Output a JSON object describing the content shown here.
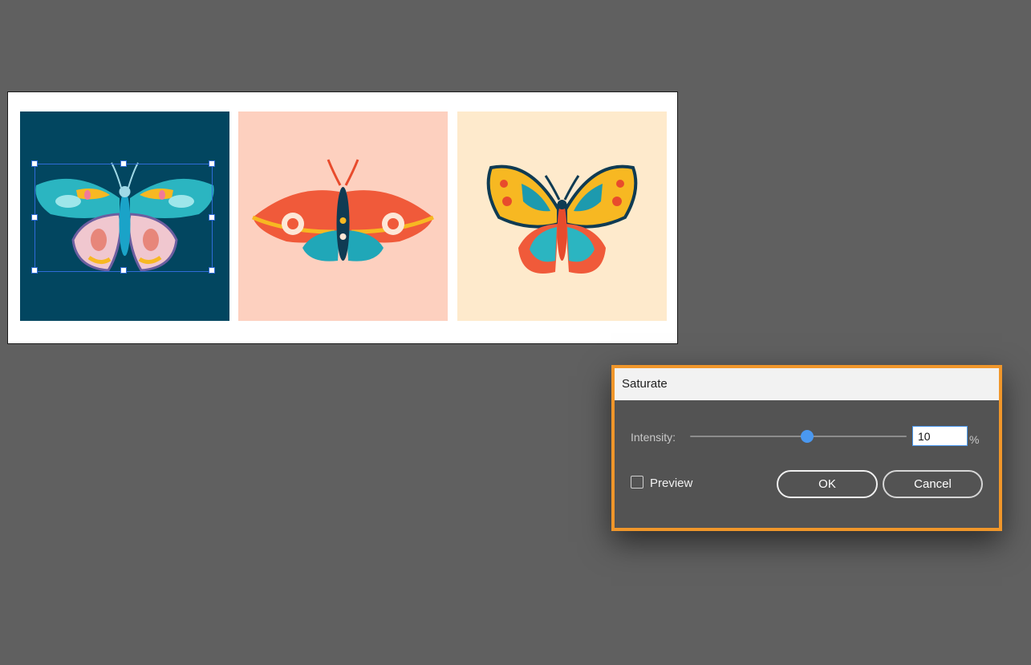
{
  "canvas": {
    "background": "#606060",
    "artboard": {
      "tiles": [
        {
          "name": "tile-dark-teal",
          "color": "#024660",
          "icon": "butterfly-icon",
          "selected": true
        },
        {
          "name": "tile-peach",
          "color": "#fdd0bf",
          "icon": "moth-icon",
          "selected": false
        },
        {
          "name": "tile-cream",
          "color": "#feeacc",
          "icon": "butterfly-icon",
          "selected": false
        }
      ]
    }
  },
  "dialog": {
    "title": "Saturate",
    "accent": "#f0962a",
    "intensity": {
      "label": "Intensity:",
      "value": "10",
      "unit": "%",
      "slider_fraction": 0.54
    },
    "preview": {
      "label": "Preview",
      "checked": false
    },
    "buttons": {
      "ok": "OK",
      "cancel": "Cancel"
    }
  }
}
